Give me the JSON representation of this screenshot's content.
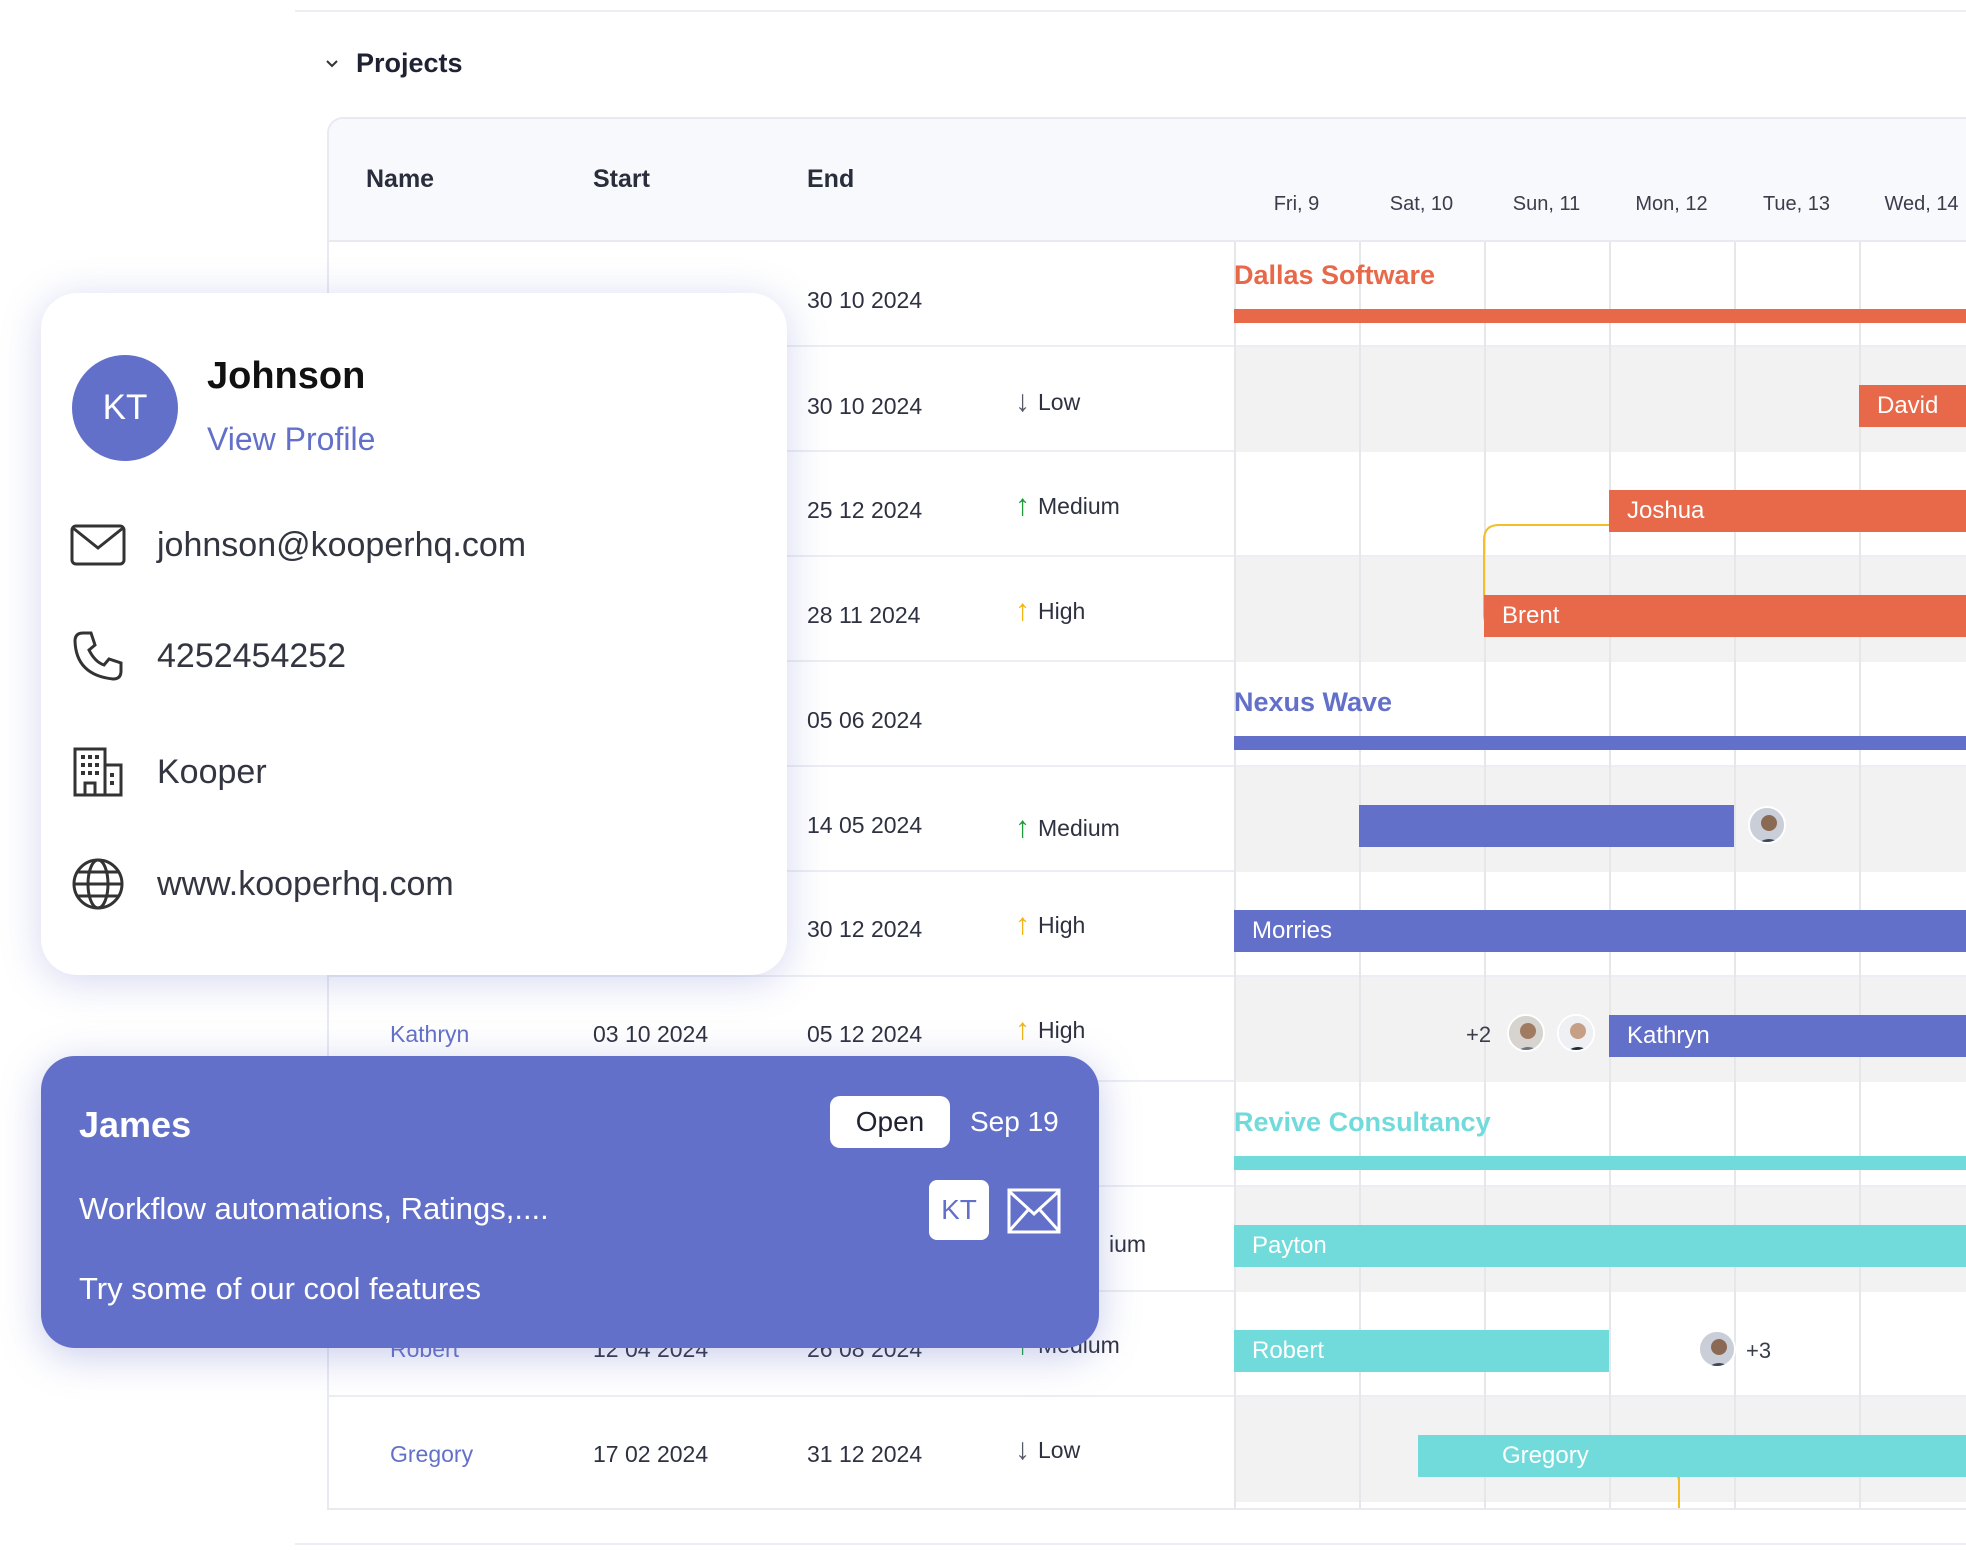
{
  "section": {
    "title": "Projects"
  },
  "columns": {
    "name": "Name",
    "start": "Start",
    "end": "End"
  },
  "days": [
    "Fri, 9",
    "Sat, 10",
    "Sun, 11",
    "Mon, 12",
    "Tue, 13",
    "Wed, 14"
  ],
  "rows": [
    {
      "name": "",
      "start": "",
      "end": "30 10 2024",
      "priority": ""
    },
    {
      "name": "",
      "start": "",
      "end": "30 10 2024",
      "priority": "Low"
    },
    {
      "name": "",
      "start": "",
      "end": "25 12 2024",
      "priority": "Medium"
    },
    {
      "name": "",
      "start": "",
      "end": "28 11 2024",
      "priority": "High"
    },
    {
      "name": "",
      "start": "",
      "end": "05 06 2024",
      "priority": ""
    },
    {
      "name": "",
      "start": "",
      "end": "14 05 2024",
      "priority": "Medium"
    },
    {
      "name": "",
      "start": "",
      "end": "30 12 2024",
      "priority": "High"
    },
    {
      "name": "Kathryn",
      "start": "03 10 2024",
      "end": "05 12 2024",
      "priority": "High"
    },
    {
      "name": "",
      "start": "",
      "end": "",
      "priority": ""
    },
    {
      "name": "",
      "start": "",
      "end": "",
      "priority": "ium"
    },
    {
      "name": "Robert",
      "start": "12 04 2024",
      "end": "26 08 2024",
      "priority": "Medium"
    },
    {
      "name": "Gregory",
      "start": "17 02 2024",
      "end": "31 12 2024",
      "priority": "Low"
    }
  ],
  "timeline": {
    "groups": [
      "Dallas Software",
      "Nexus Wave",
      "Revive Consultancy"
    ],
    "bars": [
      "David",
      "Joshua",
      "Brent",
      "Morries",
      "Kathryn",
      "Payton",
      "Robert",
      "Gregory"
    ],
    "plus_kathryn": "+2",
    "plus_robert": "+3"
  },
  "colors": {
    "orange": "#e8694a",
    "indigo": "#6370c9",
    "teal": "#71dada",
    "dep_line": "#f4bf26"
  },
  "profile": {
    "initials": "KT",
    "name": "Johnson",
    "link": "View Profile",
    "email": "johnson@kooperhq.com",
    "phone": "4252454252",
    "company": "Kooper",
    "website": "www.kooperhq.com",
    "icons": [
      "mail-icon",
      "phone-icon",
      "building-icon",
      "globe-icon"
    ]
  },
  "task": {
    "title": "James",
    "status": "Open",
    "date": "Sep 19",
    "subtitle": "Workflow automations, Ratings,....",
    "description": "Try some of our cool features",
    "assignee": "KT"
  }
}
